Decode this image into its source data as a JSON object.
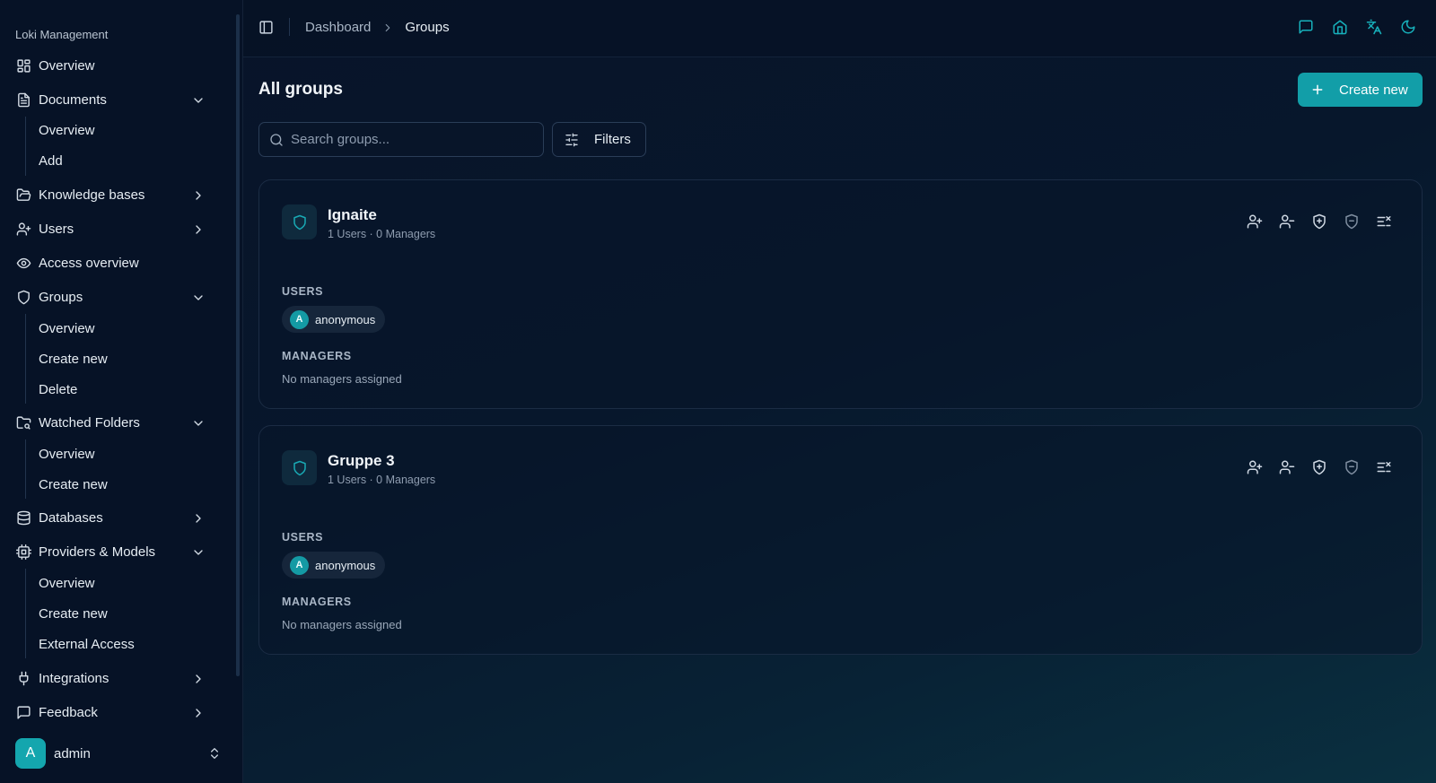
{
  "sidebar": {
    "brand": "Loki Management",
    "overview": "Overview",
    "documents": {
      "label": "Documents",
      "items": [
        "Overview",
        "Add"
      ]
    },
    "knowledge_bases": "Knowledge bases",
    "users": "Users",
    "access_overview": "Access overview",
    "groups": {
      "label": "Groups",
      "items": [
        "Overview",
        "Create new",
        "Delete"
      ]
    },
    "watched_folders": {
      "label": "Watched Folders",
      "items": [
        "Overview",
        "Create new"
      ]
    },
    "databases": "Databases",
    "providers": {
      "label": "Providers & Models",
      "items": [
        "Overview",
        "Create new",
        "External Access"
      ]
    },
    "integrations": "Integrations",
    "feedback": "Feedback",
    "user": {
      "initial": "A",
      "name": "admin"
    }
  },
  "header": {
    "breadcrumb": [
      "Dashboard",
      "Groups"
    ],
    "icons": [
      "message-square-icon",
      "home-icon",
      "languages-icon",
      "moon-icon"
    ]
  },
  "main": {
    "title": "All groups",
    "create_label": "Create new",
    "search_placeholder": "Search groups...",
    "filters_label": "Filters"
  },
  "groups": [
    {
      "name": "Ignaite",
      "meta": "1 Users · 0 Managers",
      "users_label": "USERS",
      "users": [
        {
          "initial": "A",
          "name": "anonymous"
        }
      ],
      "managers_label": "MANAGERS",
      "managers_empty": "No managers assigned"
    },
    {
      "name": "Gruppe 3",
      "meta": "1 Users · 0 Managers",
      "users_label": "USERS",
      "users": [
        {
          "initial": "A",
          "name": "anonymous"
        }
      ],
      "managers_label": "MANAGERS",
      "managers_empty": "No managers assigned"
    }
  ],
  "colors": {
    "accent": "#129ea8",
    "icon_accent": "#17b0bb",
    "background": "#071427"
  }
}
